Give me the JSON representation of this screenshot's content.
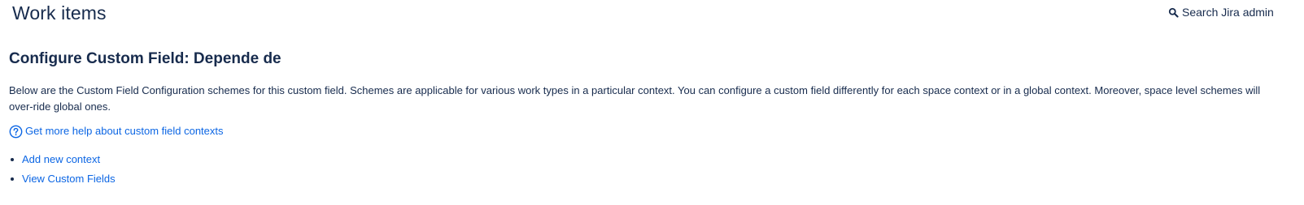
{
  "header": {
    "title": "Work items",
    "search": {
      "label": "Search Jira admin",
      "icon": "search-icon"
    }
  },
  "main": {
    "heading": "Configure Custom Field: Depende de",
    "description": "Below are the Custom Field Configuration schemes for this custom field. Schemes are applicable for various work types in a particular context. You can configure a custom field differently for each space context or in a global context. Moreover, space level schemes will over-ride global ones.",
    "help_link": {
      "label": "Get more help about custom field contexts",
      "icon": "help-circle-icon"
    },
    "links": [
      {
        "label": "Add new context"
      },
      {
        "label": "View Custom Fields"
      }
    ]
  },
  "colors": {
    "text": "#172b4d",
    "link": "#0c66e4",
    "background": "#ffffff"
  }
}
